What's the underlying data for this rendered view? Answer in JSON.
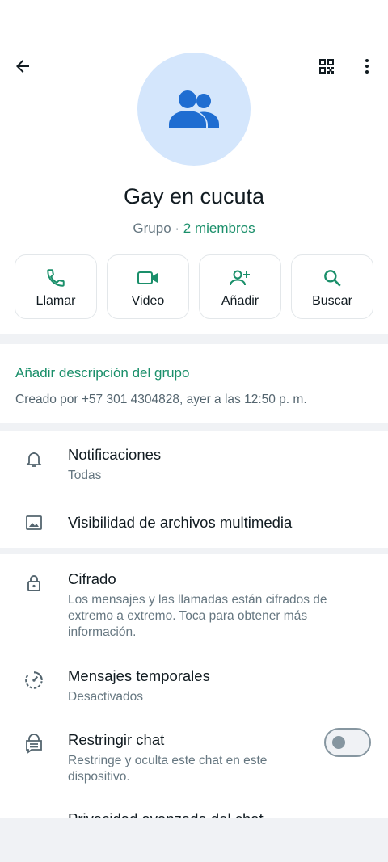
{
  "header": {
    "back_icon": "arrow-left-icon",
    "qr_icon": "qr-code-icon",
    "menu_icon": "more-vertical-icon"
  },
  "group": {
    "avatar_icon": "group-people-icon",
    "name": "Gay en cucuta",
    "type_label": "Grupo",
    "separator": " · ",
    "members": "2 miembros"
  },
  "actions": [
    {
      "label": "Llamar",
      "icon": "phone-icon"
    },
    {
      "label": "Video",
      "icon": "video-icon"
    },
    {
      "label": "Añadir",
      "icon": "add-person-icon"
    },
    {
      "label": "Buscar",
      "icon": "search-icon"
    }
  ],
  "description": {
    "add_label": "Añadir descripción del grupo",
    "created_text": "Creado por +57 301 4304828, ayer a las 12:50 p. m."
  },
  "settings": [
    {
      "title": "Notificaciones",
      "subtitle": "Todas",
      "icon": "bell-icon"
    },
    {
      "title": "Visibilidad de archivos multimedia",
      "icon": "image-icon"
    },
    {
      "title": "Cifrado",
      "subtitle": "Los mensajes y las llamadas están cifrados de extremo a extremo. Toca para obtener más información.",
      "icon": "lock-icon"
    },
    {
      "title": "Mensajes temporales",
      "subtitle": "Desactivados",
      "icon": "timer-icon"
    },
    {
      "title": "Restringir chat",
      "subtitle": "Restringe y oculta este chat en este dispositivo.",
      "icon": "chat-lock-icon",
      "toggle_on": false
    },
    {
      "title": "Privacidad avanzada del chat",
      "icon": "shield-icon"
    }
  ],
  "colors": {
    "accent": "#1a8f6a",
    "avatar_bg": "#d4e6fc",
    "avatar_icon": "#1f6dd1"
  }
}
